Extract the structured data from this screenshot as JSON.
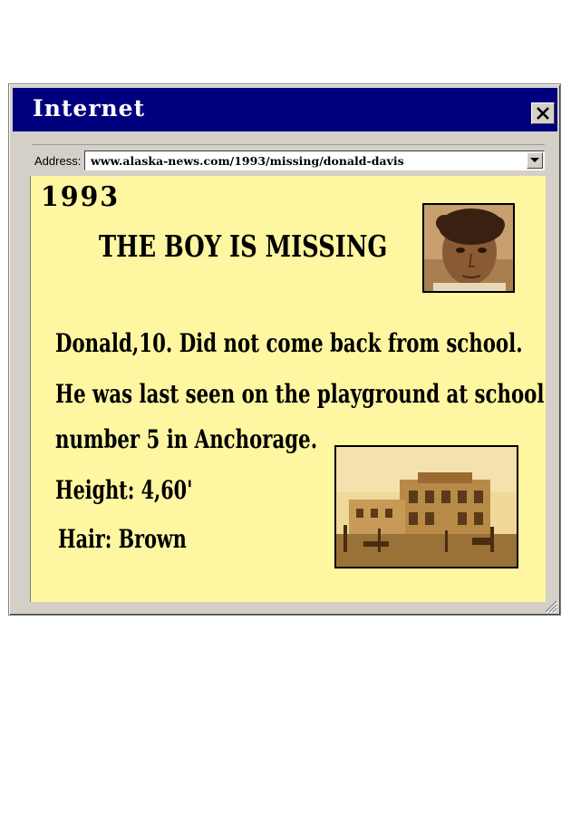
{
  "window": {
    "title": "Internet"
  },
  "address_bar": {
    "label": "Address:",
    "url": "www.alaska-news.com/1993/missing/donald-davis"
  },
  "article": {
    "year": "1993",
    "headline": "THE BOY IS MISSING",
    "lines": [
      "Donald,10. Did not come back from school.",
      "He was last seen on the playground at school",
      "number 5 in Anchorage.",
      "Height: 4,60'",
      "Hair: Brown"
    ]
  },
  "icons": {
    "close": "close-icon",
    "dropdown": "chevron-down-icon",
    "resize": "resize-grip-icon"
  },
  "colors": {
    "titlebar": "#00007f",
    "page_background": "#fef6a0",
    "window_chrome": "#d4d0c8"
  }
}
